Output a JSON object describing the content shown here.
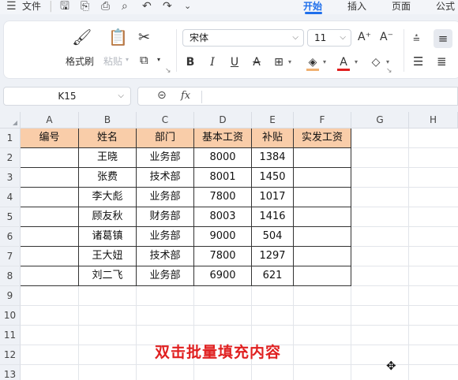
{
  "menu": {
    "file_label": "文件",
    "tabs": [
      {
        "label": "开始",
        "active": true
      },
      {
        "label": "插入",
        "active": false
      },
      {
        "label": "页面",
        "active": false
      },
      {
        "label": "公式",
        "active": false
      }
    ]
  },
  "ribbon": {
    "format_painter_label": "格式刷",
    "paste_label": "粘贴",
    "font_name": "宋体",
    "font_size": "11",
    "font_color_accent": "#e02020",
    "fill_color_accent": "#f0b070"
  },
  "formula_bar": {
    "name_box": "K15",
    "fx_label": "fx",
    "formula": ""
  },
  "sheet": {
    "columns": [
      "A",
      "B",
      "C",
      "D",
      "E",
      "F",
      "G",
      "H"
    ],
    "rows": [
      "1",
      "2",
      "3",
      "4",
      "5",
      "6",
      "7",
      "8",
      "9",
      "10",
      "11",
      "12",
      "13"
    ],
    "header_fill": "#f9cda9",
    "table_headers": [
      "编号",
      "姓名",
      "部门",
      "基本工资",
      "补贴",
      "实发工资"
    ],
    "table_rows": [
      [
        "",
        "王晓",
        "业务部",
        "8000",
        "1384",
        ""
      ],
      [
        "",
        "张费",
        "技术部",
        "8001",
        "1450",
        ""
      ],
      [
        "",
        "李大彪",
        "业务部",
        "7800",
        "1017",
        ""
      ],
      [
        "",
        "顾友秋",
        "财务部",
        "8003",
        "1416",
        ""
      ],
      [
        "",
        "诸葛镇",
        "业务部",
        "9000",
        "504",
        ""
      ],
      [
        "",
        "王大妞",
        "技术部",
        "7800",
        "1297",
        ""
      ],
      [
        "",
        "刘二飞",
        "业务部",
        "6900",
        "621",
        ""
      ]
    ]
  },
  "caption": {
    "text": "双击批量填充内容",
    "color": "#e02020"
  }
}
